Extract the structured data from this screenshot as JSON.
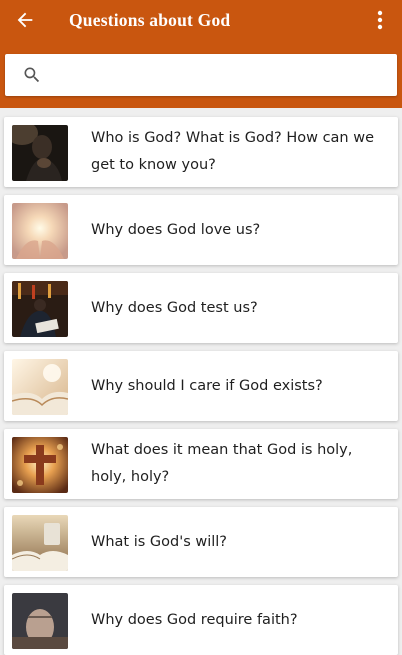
{
  "header": {
    "title": "Questions about God",
    "back_icon": "arrow-back-icon",
    "menu_icon": "more-vert-icon",
    "background": "#c9560f"
  },
  "search": {
    "placeholder": "",
    "value": "",
    "icon": "search-icon"
  },
  "questions": [
    {
      "label": "Who is God? What is God? How can we get to know you?",
      "image": "praying-man-image"
    },
    {
      "label": "Why does God love us?",
      "image": "hands-holding-light-image"
    },
    {
      "label": "Why does God test us?",
      "image": "person-writing-in-church-image"
    },
    {
      "label": "Why should I care if God exists?",
      "image": "open-bible-light-image"
    },
    {
      "label": "What does it mean that God is holy, holy, holy?",
      "image": "glowing-cross-image"
    },
    {
      "label": "What is God's will?",
      "image": "bible-and-mug-image"
    },
    {
      "label": "Why does God require faith?",
      "image": "praying-hands-image"
    }
  ]
}
